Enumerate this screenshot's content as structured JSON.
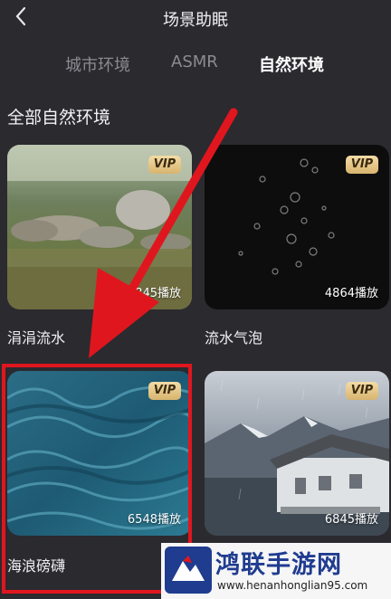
{
  "header": {
    "title": "场景助眠",
    "back_icon": "chevron-left-icon"
  },
  "tabs": [
    {
      "label": "城市环境",
      "active": false
    },
    {
      "label": "ASMR",
      "active": false
    },
    {
      "label": "自然环境",
      "active": true
    }
  ],
  "section": {
    "title": "全部自然环境"
  },
  "cards": [
    {
      "label": "涓涓流水",
      "plays": "845播放",
      "vip": "VIP",
      "image": "stream-rocks"
    },
    {
      "label": "流水气泡",
      "plays": "4864播放",
      "vip": "VIP",
      "image": "water-bubbles"
    },
    {
      "label": "海浪磅礴",
      "plays": "6548播放",
      "vip": "VIP",
      "image": "ocean-waves"
    },
    {
      "label": "",
      "plays": "6845播放",
      "vip": "VIP",
      "image": "rainy-lake-house"
    }
  ],
  "annotation": {
    "color": "#e0161e"
  },
  "watermark": {
    "name": "鸿联手游网",
    "url": "www.henanhonglian95.com"
  },
  "colors": {
    "background": "#2b2a2f",
    "vip_gold": "#e6c488",
    "accent_red": "#e0161e"
  }
}
